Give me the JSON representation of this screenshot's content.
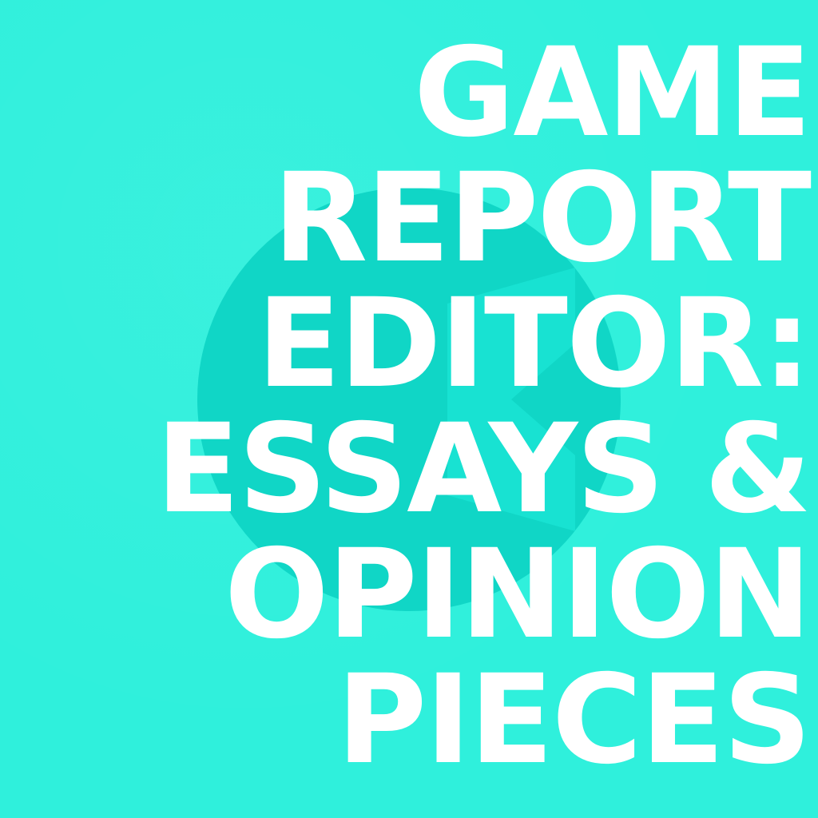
{
  "colors": {
    "background": "#2ff0dc",
    "emblem": "#10d6c6",
    "text": "#ffffff"
  },
  "headline": {
    "lines": [
      "GAME",
      "REPORT",
      "EDITOR:",
      "ESSAYS &",
      "OPINION",
      "PIECES"
    ]
  },
  "emblem": {
    "icon": "logo-circle-icon"
  }
}
